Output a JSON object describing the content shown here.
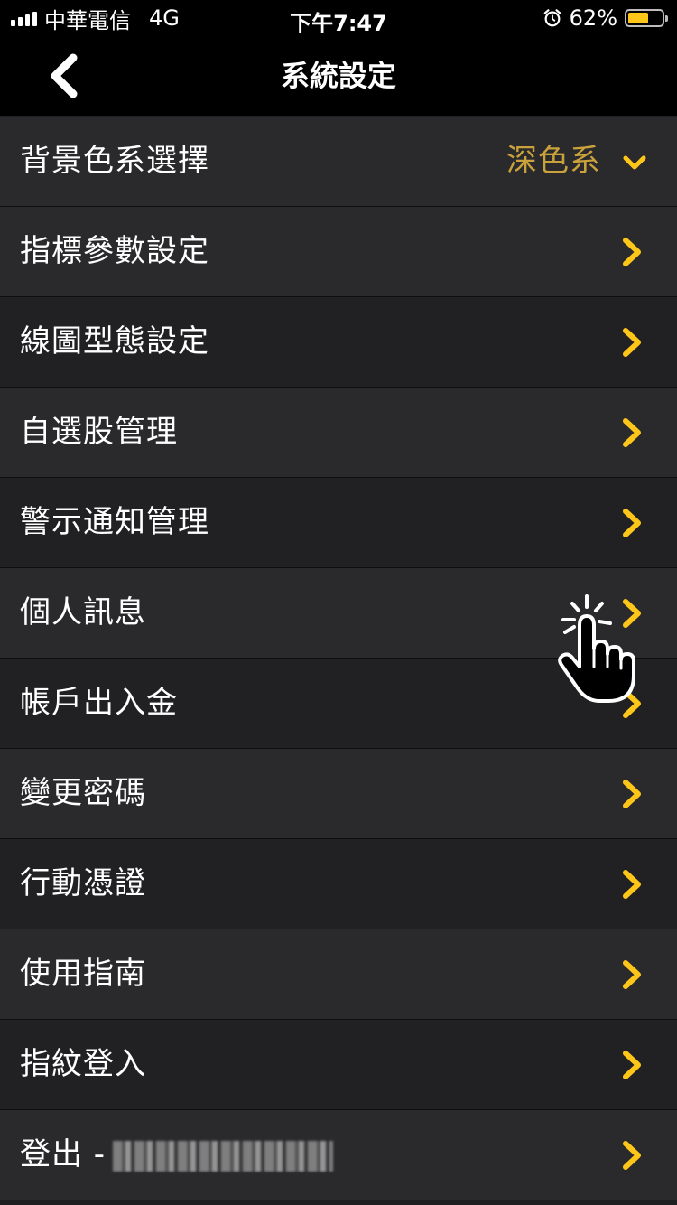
{
  "status_bar": {
    "carrier": "中華電信",
    "network": "4G",
    "time": "下午7:47",
    "battery": "62%",
    "battery_level": 0.62,
    "icons": [
      "signal-icon",
      "alarm-icon",
      "battery-icon"
    ]
  },
  "nav": {
    "title": "系統設定",
    "back_icon": "chevron-left-icon"
  },
  "colors": {
    "accent": "#ffc61a",
    "value_text": "#c9a23c",
    "background": "#1f1f21",
    "bar": "#000000"
  },
  "menu": {
    "items": [
      {
        "label": "背景色系選擇",
        "value": "深色系",
        "icon": "chevron-down-icon"
      },
      {
        "label": "指標參數設定",
        "icon": "chevron-right-icon"
      },
      {
        "label": "線圖型態設定",
        "icon": "chevron-right-icon"
      },
      {
        "label": "自選股管理",
        "icon": "chevron-right-icon"
      },
      {
        "label": "警示通知管理",
        "icon": "chevron-right-icon"
      },
      {
        "label": "個人訊息",
        "icon": "chevron-right-icon"
      },
      {
        "label": "帳戶出入金",
        "icon": "chevron-right-icon"
      },
      {
        "label": "變更密碼",
        "icon": "chevron-right-icon"
      },
      {
        "label": "行動憑證",
        "icon": "chevron-right-icon"
      },
      {
        "label": "使用指南",
        "icon": "chevron-right-icon"
      },
      {
        "label": "指紋登入",
        "icon": "chevron-right-icon"
      },
      {
        "label": "登出 -",
        "icon": "chevron-right-icon"
      }
    ]
  },
  "overlay": {
    "icon": "tap-hand-icon"
  }
}
